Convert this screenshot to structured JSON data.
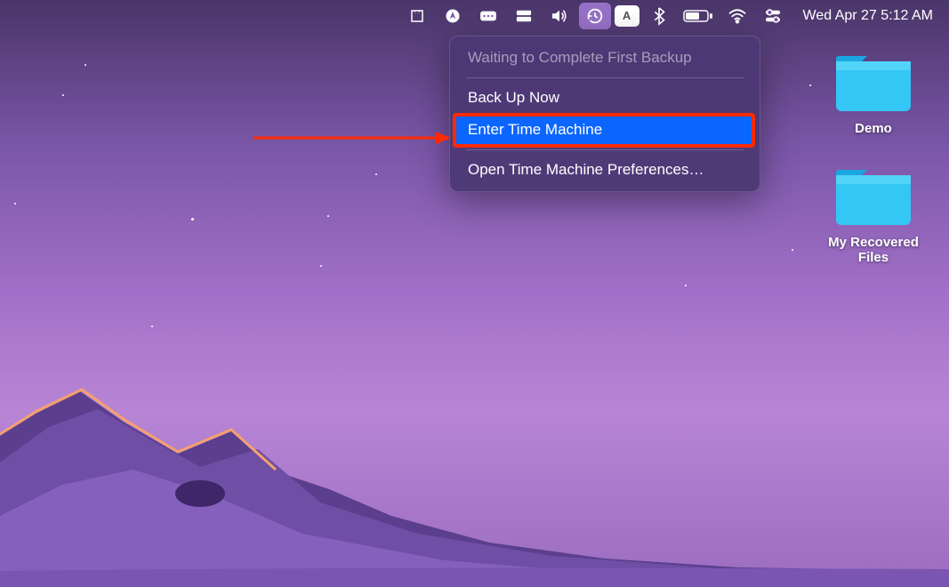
{
  "menubar": {
    "datetime": "Wed Apr 27  5:12 AM",
    "text_input_indicator": "A"
  },
  "dropdown": {
    "status": "Waiting to Complete First Backup",
    "backup_now": "Back Up Now",
    "enter_tm": "Enter Time Machine",
    "open_prefs": "Open Time Machine Preferences…"
  },
  "desktop": {
    "items": [
      {
        "label": "Demo"
      },
      {
        "label": "My Recovered Files"
      }
    ]
  }
}
